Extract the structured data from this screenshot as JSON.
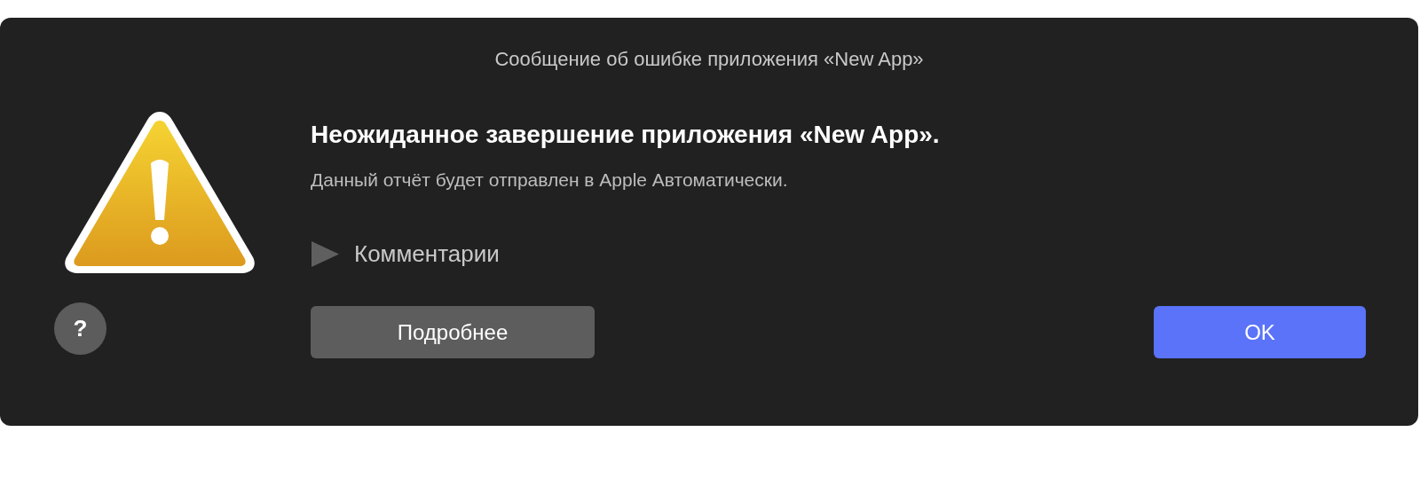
{
  "window": {
    "title": "Сообщение об ошибке приложения «New App»"
  },
  "alert": {
    "heading": "Неожиданное завершение приложения «New App».",
    "message": "Данный отчёт будет отправлен в Apple Автоматически."
  },
  "disclosure": {
    "label": "Комментарии",
    "expanded": false
  },
  "help_button": {
    "label": "?"
  },
  "buttons": [
    {
      "label": "Подробнее",
      "kind": "secondary"
    },
    {
      "label": "OK",
      "kind": "primary"
    }
  ]
}
